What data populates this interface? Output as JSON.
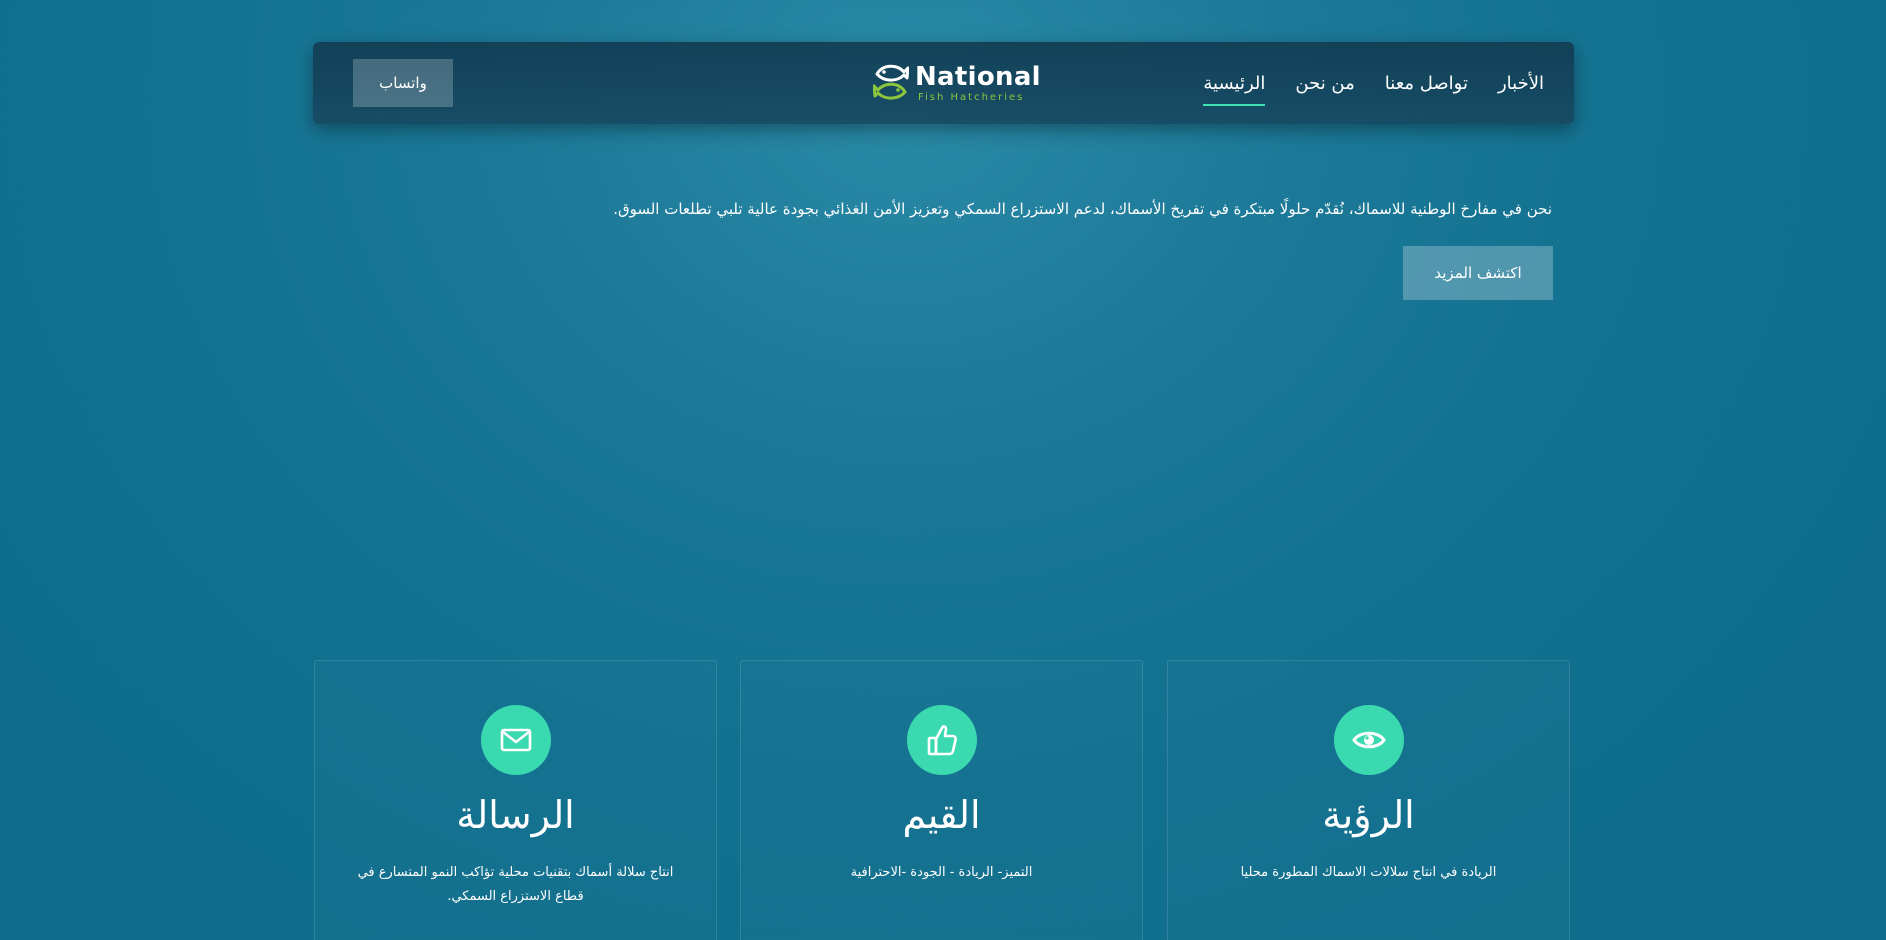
{
  "nav": {
    "links": [
      {
        "label": "الرئيسية",
        "active": true
      },
      {
        "label": "من نحن",
        "active": false
      },
      {
        "label": "تواصل معنا",
        "active": false
      },
      {
        "label": "الأخبار",
        "active": false
      }
    ],
    "logo": {
      "title": "National",
      "subtitle": "Fish Hatcheries",
      "icon": "fish-logo-icon"
    },
    "whatsapp_label": "واتساب"
  },
  "hero": {
    "text": "نحن في مفارخ الوطنية للاسماك، نُقدّم حلولًا مبتكرة في تفريخ الأسماك، لدعم الاستزراع السمكي وتعزيز الأمن الغذائي بجودة عالية تلبي تطلعات السوق.",
    "button_label": "اكتشف المزيد"
  },
  "cards": [
    {
      "title": "الرؤية",
      "description": "الريادة في انتاج سلالات الاسماك المطورة محليا",
      "icon": "eye-icon"
    },
    {
      "title": "القيم",
      "description": "التميز- الريادة - الجودة -الاحترافية",
      "icon": "thumbs-up-icon"
    },
    {
      "title": "الرسالة",
      "description": "انتاج سلالة أسماك بتقنيات محلية تؤاكب النمو المتسارع في قطاع الاستزراع السمكي.",
      "icon": "envelope-icon"
    }
  ],
  "colors": {
    "accent": "#3bd9b0",
    "logo_green": "#8cc63f",
    "background": "#11708f"
  }
}
